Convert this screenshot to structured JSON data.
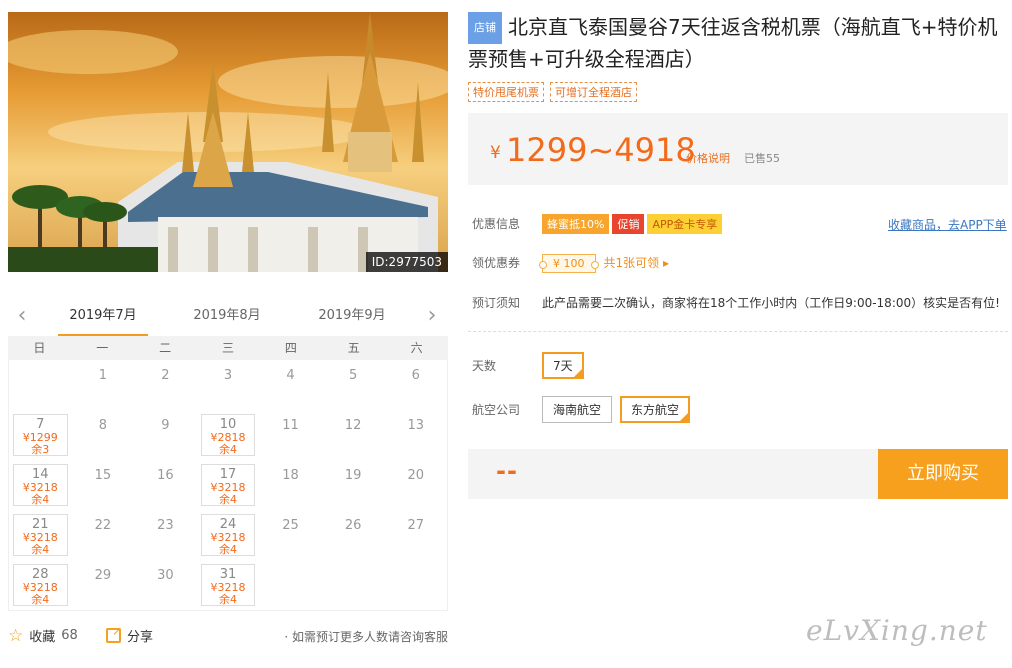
{
  "hero": {
    "image_id": "ID:2977503"
  },
  "calendar": {
    "prev_icon": "chevron-left-icon",
    "next_icon": "chevron-right-icon",
    "months": [
      "2019年7月",
      "2019年8月",
      "2019年9月"
    ],
    "active_month_index": 0,
    "weekdays": [
      "日",
      "一",
      "二",
      "三",
      "四",
      "五",
      "六"
    ],
    "days": [
      {
        "day": ""
      },
      {
        "day": "1"
      },
      {
        "day": "2"
      },
      {
        "day": "3"
      },
      {
        "day": "4"
      },
      {
        "day": "5"
      },
      {
        "day": "6"
      },
      {
        "day": "7",
        "price": "¥1299",
        "stock": "余3"
      },
      {
        "day": "8"
      },
      {
        "day": "9"
      },
      {
        "day": "10",
        "price": "¥2818",
        "stock": "余4"
      },
      {
        "day": "11"
      },
      {
        "day": "12"
      },
      {
        "day": "13"
      },
      {
        "day": "14",
        "price": "¥3218",
        "stock": "余4"
      },
      {
        "day": "15"
      },
      {
        "day": "16"
      },
      {
        "day": "17",
        "price": "¥3218",
        "stock": "余4"
      },
      {
        "day": "18"
      },
      {
        "day": "19"
      },
      {
        "day": "20"
      },
      {
        "day": "21",
        "price": "¥3218",
        "stock": "余4"
      },
      {
        "day": "22"
      },
      {
        "day": "23"
      },
      {
        "day": "24",
        "price": "¥3218",
        "stock": "余4"
      },
      {
        "day": "25"
      },
      {
        "day": "26"
      },
      {
        "day": "27"
      },
      {
        "day": "28",
        "price": "¥3218",
        "stock": "余4"
      },
      {
        "day": "29"
      },
      {
        "day": "30"
      },
      {
        "day": "31",
        "price": "¥3218",
        "stock": "余4"
      }
    ]
  },
  "footer": {
    "fav_label": "收藏",
    "fav_count": "68",
    "share_label": "分享",
    "note": "· 如需预订更多人数请咨询客服"
  },
  "product": {
    "shop_badge": "店铺",
    "title": "北京直飞泰国曼谷7天往返含税机票（海航直飞+特价机票预售+可升级全程酒店）",
    "tags": [
      "特价甩尾机票",
      "可增订全程酒店"
    ],
    "price_symbol": "¥",
    "price_range": "1299~4918",
    "price_note": "价格说明",
    "sold": "已售55"
  },
  "promotions": {
    "label": "优惠信息",
    "items": [
      {
        "text": "蜂蜜抵10%",
        "style": "orange"
      },
      {
        "text": "促销",
        "style": "red"
      },
      {
        "text": "APP金卡专享",
        "style": "yellow"
      }
    ],
    "app_link": "收藏商品，去APP下单"
  },
  "coupon": {
    "label": "领优惠券",
    "value": "¥ 100",
    "more": "共1张可领 ▸"
  },
  "notice": {
    "label": "预订须知",
    "text": "此产品需要二次确认，商家将在18个工作小时内（工作日9:00-18:00）核实是否有位!"
  },
  "options": {
    "days_label": "天数",
    "days": [
      {
        "text": "7天",
        "selected": true
      }
    ],
    "airline_label": "航空公司",
    "airlines": [
      {
        "text": "海南航空",
        "selected": false
      },
      {
        "text": "东方航空",
        "selected": true
      }
    ]
  },
  "buy": {
    "placeholder": "--",
    "button": "立即购买"
  },
  "watermark": "eLvXing.net",
  "colors": {
    "accent": "#f7a01d",
    "price": "#f26b1b",
    "link": "#3a77c2"
  }
}
